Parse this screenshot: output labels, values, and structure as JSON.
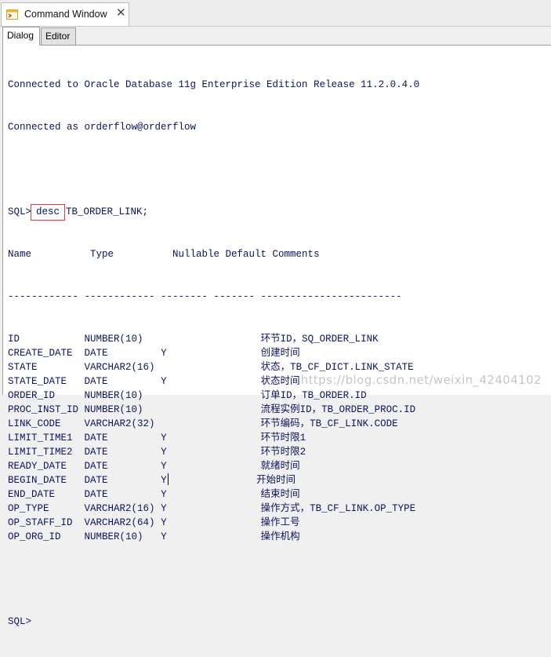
{
  "window": {
    "title": "Command Window",
    "close_glyph": "✕",
    "icon": "command-window-icon"
  },
  "tabs": [
    {
      "label": "Dialog",
      "active": true
    },
    {
      "label": "Editor",
      "active": false
    }
  ],
  "console": {
    "connect_line1": "Connected to Oracle Database 11g Enterprise Edition Release 11.2.0.4.0",
    "connect_line2": "Connected as orderflow@orderflow",
    "prompt": "SQL>",
    "command_keyword": "desc",
    "command_rest": "TB_ORDER_LINK;",
    "header": "Name          Type          Nullable Default Comments",
    "separator": "------------ ------------ -------- ------- ------------------------",
    "rows": [
      {
        "name": "ID",
        "type": "NUMBER(10)",
        "nullable": "",
        "comment": "环节ID，SQ_ORDER_LINK"
      },
      {
        "name": "CREATE_DATE",
        "type": "DATE",
        "nullable": "Y",
        "comment": "创建时间"
      },
      {
        "name": "STATE",
        "type": "VARCHAR2(16)",
        "nullable": "",
        "comment": "状态，TB_CF_DICT.LINK_STATE"
      },
      {
        "name": "STATE_DATE",
        "type": "DATE",
        "nullable": "Y",
        "comment": "状态时间"
      },
      {
        "name": "ORDER_ID",
        "type": "NUMBER(10)",
        "nullable": "",
        "comment": "订单ID，TB_ORDER.ID"
      },
      {
        "name": "PROC_INST_ID",
        "type": "NUMBER(10)",
        "nullable": "",
        "comment": "流程实例ID，TB_ORDER_PROC.ID"
      },
      {
        "name": "LINK_CODE",
        "type": "VARCHAR2(32)",
        "nullable": "",
        "comment": "环节编码，TB_CF_LINK.CODE"
      },
      {
        "name": "LIMIT_TIME1",
        "type": "DATE",
        "nullable": "Y",
        "comment": "环节时限1"
      },
      {
        "name": "LIMIT_TIME2",
        "type": "DATE",
        "nullable": "Y",
        "comment": "环节时限2"
      },
      {
        "name": "READY_DATE",
        "type": "DATE",
        "nullable": "Y",
        "comment": "就绪时间"
      },
      {
        "name": "BEGIN_DATE",
        "type": "DATE",
        "nullable": "Y",
        "comment": "开始时间"
      },
      {
        "name": "END_DATE",
        "type": "DATE",
        "nullable": "Y",
        "comment": "结束时间"
      },
      {
        "name": "OP_TYPE",
        "type": "VARCHAR2(16)",
        "nullable": "Y",
        "comment": "操作方式，TB_CF_LINK.OP_TYPE"
      },
      {
        "name": "OP_STAFF_ID",
        "type": "VARCHAR2(64)",
        "nullable": "Y",
        "comment": "操作工号"
      },
      {
        "name": "OP_ORG_ID",
        "type": "NUMBER(10)",
        "nullable": "Y",
        "comment": "操作机构"
      }
    ],
    "final_prompt": "SQL>"
  },
  "watermark": "https://blog.csdn.net/weixin_42404102",
  "colors": {
    "console_text": "#0b1460",
    "highlight_box": "#e53935",
    "background": "#ffffff"
  }
}
